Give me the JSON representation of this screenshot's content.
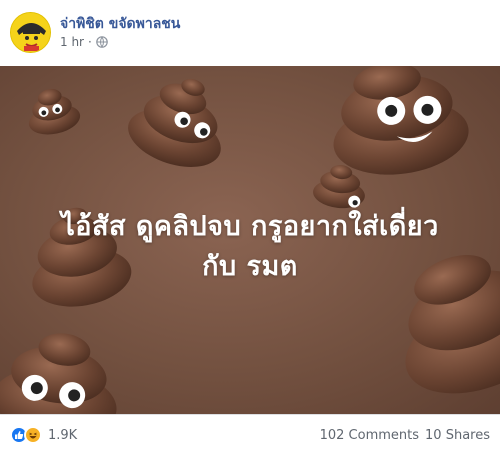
{
  "post": {
    "author": "จ่าพิชิต ขจัดพาลชน",
    "timestamp": "1 hr",
    "separator": "·",
    "audience_icon": "globe-icon"
  },
  "media": {
    "line1": "ไอ้สัส ดูคลิปจบ กรูอยากใส่เดี่ยว",
    "line2": "กับ รมต",
    "colors": {
      "background": "#735140",
      "poop": "#6b4432"
    }
  },
  "footer": {
    "reaction_icons": [
      "like-icon",
      "haha-icon"
    ],
    "reaction_count": "1.9K",
    "comments": "102 Comments",
    "shares": "10 Shares"
  }
}
